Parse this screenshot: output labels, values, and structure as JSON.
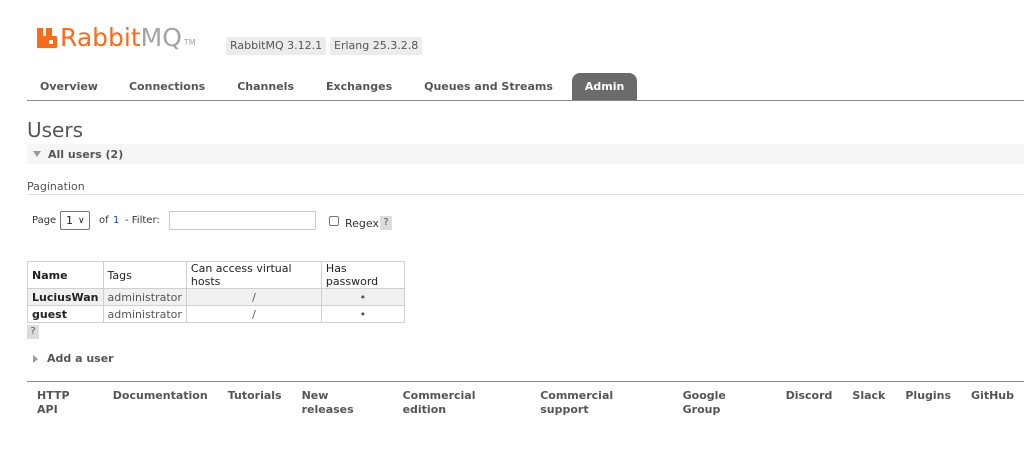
{
  "header": {
    "logo": {
      "part1": "Rabbit",
      "part2": "MQ",
      "tm": "TM"
    },
    "version_badge": "RabbitMQ 3.12.1",
    "erlang_badge": "Erlang 25.3.2.8",
    "colors": {
      "brand_orange": "#f66c1a",
      "brand_gray": "#a3a3a3"
    }
  },
  "tabs": [
    {
      "label": "Overview"
    },
    {
      "label": "Connections"
    },
    {
      "label": "Channels"
    },
    {
      "label": "Exchanges"
    },
    {
      "label": "Queues and Streams"
    },
    {
      "label": "Admin",
      "active": true
    }
  ],
  "page": {
    "title": "Users",
    "section_label": "All users (2)",
    "pagination_label": "Pagination",
    "page_label": "Page",
    "page_value": "1",
    "of_label": "of",
    "total_pages": "1",
    "filter_label": "- Filter:",
    "filter_value": "",
    "regex_label": "Regex",
    "help_label": "?",
    "table": {
      "headers": [
        "Name",
        "Tags",
        "Can access virtual hosts",
        "Has password"
      ],
      "rows": [
        {
          "name": "LuciusWan",
          "tags": "administrator",
          "vhosts": "/",
          "has_password": "•"
        },
        {
          "name": "guest",
          "tags": "administrator",
          "vhosts": "/",
          "has_password": "•"
        }
      ]
    },
    "table_help_label": "?",
    "add_user_label": "Add a user"
  },
  "footer": {
    "links": [
      "HTTP API",
      "Documentation",
      "Tutorials",
      "New releases",
      "Commercial edition",
      "Commercial support",
      "Google Group",
      "Discord",
      "Slack",
      "Plugins",
      "GitHub"
    ]
  }
}
